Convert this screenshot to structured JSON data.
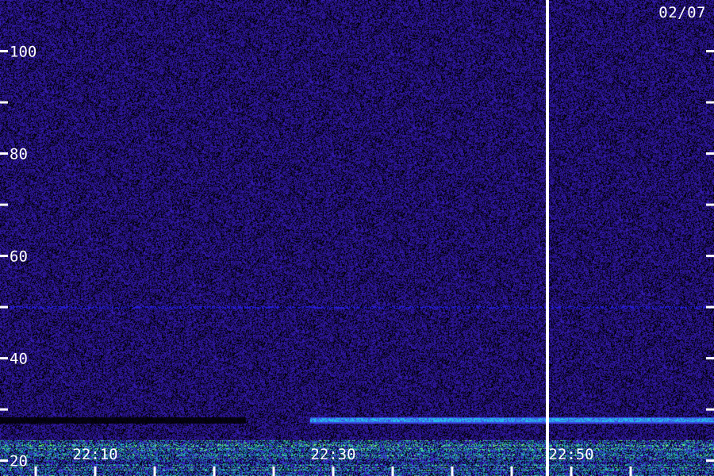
{
  "date_label": "02/07",
  "colors": {
    "background": "#000000",
    "noise_low": "#1a0a55",
    "noise_high": "#3a20c8",
    "band_cyan": "#2ad4e8",
    "band_green": "#7cff6a",
    "axis": "#ffffff",
    "cursor": "#ffffff"
  },
  "chart_data": {
    "type": "heatmap",
    "title": "",
    "xlabel": "",
    "ylabel": "",
    "ylim": [
      17,
      110
    ],
    "y_ticks": [
      20,
      30,
      40,
      50,
      60,
      70,
      80,
      90,
      100
    ],
    "y_tick_labels": [
      {
        "value": 20,
        "text": "20"
      },
      {
        "value": 40,
        "text": "40"
      },
      {
        "value": 60,
        "text": "60"
      },
      {
        "value": 80,
        "text": "80"
      },
      {
        "value": 100,
        "text": "100"
      }
    ],
    "x_tick_labels": [
      {
        "value": "22:10",
        "text": "22:10"
      },
      {
        "value": "22:30",
        "text": "22:30"
      },
      {
        "value": "22:50",
        "text": "22:50"
      }
    ],
    "x_minor_ticks": [
      "22:05",
      "22:10",
      "22:15",
      "22:20",
      "22:25",
      "22:30",
      "22:35",
      "22:40",
      "22:45",
      "22:50",
      "22:55"
    ],
    "xlim": [
      "22:02",
      "23:02"
    ],
    "cursor_time": "22:48",
    "features": {
      "noise_floor_below": 24,
      "band_level": 28,
      "faint_line_level": 50
    },
    "grid": false,
    "legend": "none"
  }
}
